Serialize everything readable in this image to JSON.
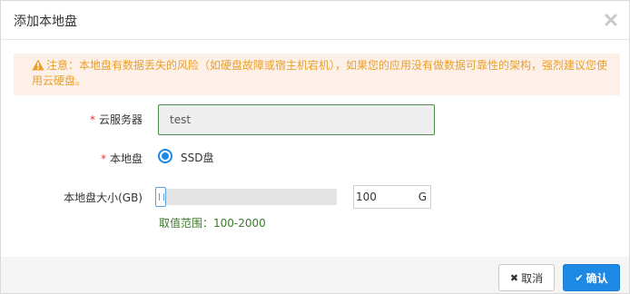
{
  "dialog": {
    "title": "添加本地盘",
    "close_icon": "close-icon"
  },
  "alert": {
    "icon": "warning-icon",
    "text": "注意：本地盘有数据丢失的风险（如硬盘故障或宿主机宕机），如果您的应用没有做数据可靠性的架构，强烈建议您使用云硬盘。",
    "color": "#e9a02b",
    "background": "#fdf0e8"
  },
  "form": {
    "server": {
      "required_mark": "*",
      "label": "云服务器",
      "value": "test"
    },
    "local_disk": {
      "required_mark": "*",
      "label": "本地盘",
      "option_label": "SSD盘",
      "selected": true
    },
    "size": {
      "label": "本地盘大小(GB)",
      "value": "100",
      "unit": "G",
      "range_hint": "取值范围：100-2000",
      "slider_level": 0
    }
  },
  "footer": {
    "cancel_label": "取消",
    "confirm_label": "确认"
  },
  "colors": {
    "primary": "#1e88e5",
    "required": "#e4393c",
    "hint": "#3a7a2a"
  }
}
